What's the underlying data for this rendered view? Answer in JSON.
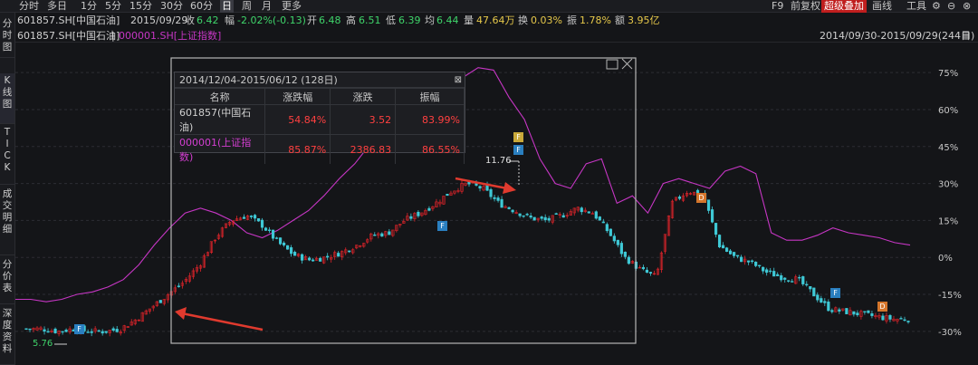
{
  "toolbar": {
    "periods": [
      "分时",
      "多日",
      "1分",
      "5分",
      "15分",
      "30分",
      "60分",
      "日",
      "周",
      "月",
      "更多"
    ],
    "active_period": "日",
    "right_buttons": [
      "F9",
      "前复权",
      "超级叠加",
      "画线",
      "工具"
    ],
    "highlight_button": "超级叠加"
  },
  "quote": {
    "code": "601857.SH[中国石油]",
    "date": "2015/09/29",
    "close_label": "收",
    "close": "6.42",
    "change_label": "幅",
    "change": "-2.02%(-0.13)",
    "open_label": "开",
    "open": "6.48",
    "high_label": "高",
    "high": "6.51",
    "low_label": "低",
    "low": "6.39",
    "avg_label": "均",
    "avg": "6.44",
    "vol_label": "量",
    "vol": "47.64万",
    "turnover_label": "换",
    "turnover": "0.03%",
    "amp_label": "振",
    "amp": "1.78%",
    "amount_label": "额",
    "amount": "3.95亿"
  },
  "overlay_legend": {
    "main": "601857.SH[中国石油]",
    "sep": "|",
    "index": "000001.SH[上证指数]",
    "range": "2014/09/30-2015/09/29(244日)"
  },
  "sidebar": [
    "分时图",
    "K线图",
    "TICK",
    "成交明细",
    "分价表",
    "深度资料"
  ],
  "stats": {
    "header": "2014/12/04-2015/06/12 (128日)",
    "columns": [
      "名称",
      "涨跌幅",
      "涨跌",
      "振幅"
    ],
    "rows": [
      {
        "name": "601857(中国石油)",
        "pct": "54.84%",
        "chg": "3.52",
        "amp": "83.99%"
      },
      {
        "name": "000001(上证指数)",
        "pct": "85.87%",
        "chg": "2386.83",
        "amp": "86.55%"
      }
    ]
  },
  "annotations": {
    "high": "11.76",
    "low": "5.76",
    "markers": [
      "F",
      "F",
      "F",
      "F",
      "D",
      "D"
    ]
  },
  "colors": {
    "up": "#e0242a",
    "down": "#3fc9d6",
    "index_line": "#c636c4",
    "arrow": "#e03a2e",
    "background": "#141518",
    "highlight": "#c01e1e"
  },
  "chart_data": {
    "type": "line",
    "y_axis_labels": [
      "75%",
      "60%",
      "45%",
      "30%",
      "15%",
      "0%",
      "-15%",
      "-30%"
    ],
    "y_ticks": [
      75,
      60,
      45,
      30,
      15,
      0,
      -15,
      -30
    ],
    "ylim": [
      -33,
      78
    ],
    "series": [
      {
        "name": "000001.SH[上证指数]",
        "values": [
          -17,
          -17,
          -18,
          -17,
          -15,
          -14,
          -12,
          -9,
          -3,
          5,
          12,
          18,
          20,
          18,
          15,
          10,
          8,
          11,
          15,
          19,
          25,
          32,
          38,
          46,
          54,
          48,
          57,
          55,
          66,
          73,
          77,
          76,
          65,
          56,
          40,
          30,
          28,
          38,
          40,
          22,
          25,
          18,
          30,
          32,
          30,
          28,
          35,
          37,
          34,
          10,
          7,
          7,
          9,
          12,
          10,
          9,
          8,
          6,
          5
        ]
      },
      {
        "name": "601857.SH[中国石油]",
        "values": [
          -29,
          -29,
          -30,
          -29,
          -30,
          -30,
          -29,
          -25,
          -20,
          -15,
          -10,
          -3,
          8,
          15,
          17,
          13,
          6,
          1,
          -1,
          0,
          2,
          5,
          9,
          10,
          15,
          18,
          22,
          27,
          30,
          28,
          22,
          19,
          16,
          15,
          17,
          20,
          18,
          10,
          0,
          -5,
          -8,
          22,
          27,
          25,
          5,
          0,
          -2,
          -6,
          -8,
          -9,
          -15,
          -21,
          -22,
          -23,
          -24,
          -25,
          -25
        ]
      }
    ]
  }
}
